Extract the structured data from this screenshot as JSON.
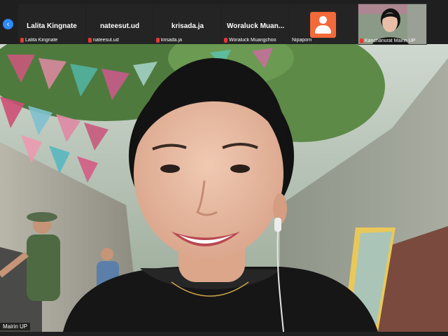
{
  "gallery": {
    "nav_icon": "chevron-left-icon",
    "tiles": [
      {
        "display_name": "Lalita Kingnate",
        "label": "Lalita Kingnate",
        "muted": true
      },
      {
        "display_name": "nateesut.ud",
        "label": "nateesut.ud",
        "muted": true
      },
      {
        "display_name": "krisada.ja",
        "label": "krisada.ja",
        "muted": true
      },
      {
        "display_name": "Woraluck  Muan...",
        "label": "Woraluck Muangchoo",
        "muted": true
      },
      {
        "display_name": "",
        "label": "Nipaporn",
        "muted": false,
        "avatar": "user-icon",
        "avatar_color": "#f26a3a"
      }
    ],
    "self_view": {
      "label": "Kanchanurat Mairin UP",
      "muted": true
    }
  },
  "main_video": {
    "speaker_label": "Mairin UP"
  },
  "colors": {
    "accent": "#2d8cff",
    "muted_mic": "#e53935",
    "tile_bg": "#242424"
  }
}
